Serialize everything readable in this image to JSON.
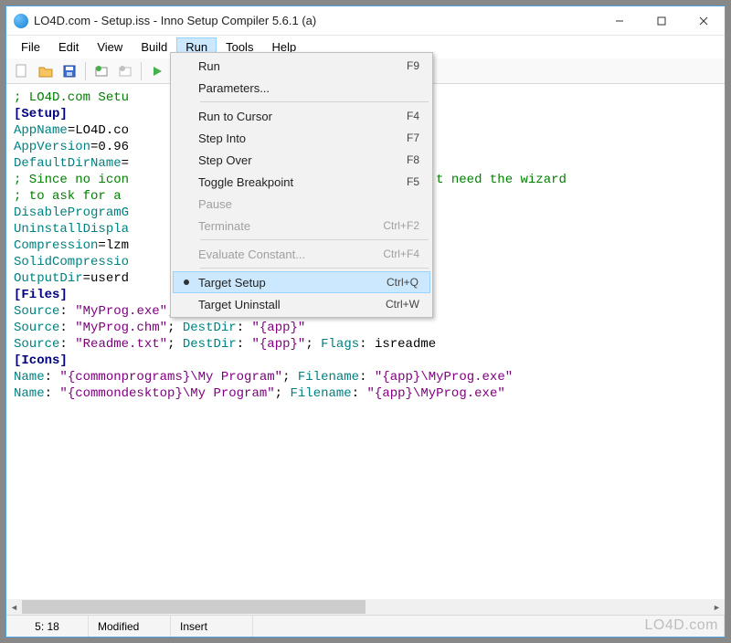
{
  "title": "LO4D.com - Setup.iss - Inno Setup Compiler 5.6.1 (a)",
  "menubar": [
    "File",
    "Edit",
    "View",
    "Build",
    "Run",
    "Tools",
    "Help"
  ],
  "active_menu_index": 4,
  "dropdown": {
    "items": [
      {
        "label": "Run",
        "accel": "F9",
        "type": "item"
      },
      {
        "label": "Parameters...",
        "accel": "",
        "type": "item"
      },
      {
        "type": "sep"
      },
      {
        "label": "Run to Cursor",
        "accel": "F4",
        "type": "item"
      },
      {
        "label": "Step Into",
        "accel": "F7",
        "type": "item"
      },
      {
        "label": "Step Over",
        "accel": "F8",
        "type": "item"
      },
      {
        "label": "Toggle Breakpoint",
        "accel": "F5",
        "type": "item"
      },
      {
        "label": "Pause",
        "accel": "",
        "type": "item",
        "disabled": true
      },
      {
        "label": "Terminate",
        "accel": "Ctrl+F2",
        "type": "item",
        "disabled": true
      },
      {
        "type": "sep"
      },
      {
        "label": "Evaluate Constant...",
        "accel": "Ctrl+F4",
        "type": "item",
        "disabled": true
      },
      {
        "type": "sep"
      },
      {
        "label": "Target Setup",
        "accel": "Ctrl+Q",
        "type": "item",
        "bullet": true,
        "hover": true
      },
      {
        "label": "Target Uninstall",
        "accel": "Ctrl+W",
        "type": "item"
      }
    ]
  },
  "editor": {
    "lines": [
      [
        {
          "c": "c-green",
          "t": "; LO4D.com Setu"
        }
      ],
      [
        {
          "t": ""
        }
      ],
      [
        {
          "c": "c-navy c-bold",
          "t": "[Setup]"
        }
      ],
      [
        {
          "c": "c-teal",
          "t": "AppName"
        },
        {
          "t": "=LO4D.co"
        }
      ],
      [
        {
          "c": "c-teal",
          "t": "AppVersion"
        },
        {
          "t": "=0.96"
        }
      ],
      [
        {
          "c": "c-teal",
          "t": "DefaultDirName"
        },
        {
          "t": "="
        }
      ],
      [
        {
          "c": "c-green",
          "t": "; Since no icon                              \", we don't need the wizard"
        }
      ],
      [
        {
          "c": "c-green",
          "t": "; to ask for a "
        }
      ],
      [
        {
          "c": "c-teal",
          "t": "DisableProgramG"
        }
      ],
      [
        {
          "c": "c-teal",
          "t": "UninstallDispla"
        }
      ],
      [
        {
          "c": "c-teal",
          "t": "Compression"
        },
        {
          "t": "=lzm"
        }
      ],
      [
        {
          "c": "c-teal",
          "t": "SolidCompressio"
        }
      ],
      [
        {
          "c": "c-teal",
          "t": "OutputDir"
        },
        {
          "t": "=userd                             t"
        }
      ],
      [
        {
          "t": ""
        }
      ],
      [
        {
          "c": "c-navy c-bold",
          "t": "[Files]"
        }
      ],
      [
        {
          "c": "c-teal",
          "t": "Source"
        },
        {
          "t": ": "
        },
        {
          "c": "c-purple",
          "t": "\"MyProg.exe\""
        },
        {
          "t": "; "
        },
        {
          "c": "c-teal",
          "t": "DestDir"
        },
        {
          "t": ": "
        },
        {
          "c": "c-purple",
          "t": "\"{app}\""
        }
      ],
      [
        {
          "c": "c-teal",
          "t": "Source"
        },
        {
          "t": ": "
        },
        {
          "c": "c-purple",
          "t": "\"MyProg.chm\""
        },
        {
          "t": "; "
        },
        {
          "c": "c-teal",
          "t": "DestDir"
        },
        {
          "t": ": "
        },
        {
          "c": "c-purple",
          "t": "\"{app}\""
        }
      ],
      [
        {
          "c": "c-teal",
          "t": "Source"
        },
        {
          "t": ": "
        },
        {
          "c": "c-purple",
          "t": "\"Readme.txt\""
        },
        {
          "t": "; "
        },
        {
          "c": "c-teal",
          "t": "DestDir"
        },
        {
          "t": ": "
        },
        {
          "c": "c-purple",
          "t": "\"{app}\""
        },
        {
          "t": "; "
        },
        {
          "c": "c-teal",
          "t": "Flags"
        },
        {
          "t": ": isreadme"
        }
      ],
      [
        {
          "t": ""
        }
      ],
      [
        {
          "c": "c-navy c-bold",
          "t": "[Icons]"
        }
      ],
      [
        {
          "c": "c-teal",
          "t": "Name"
        },
        {
          "t": ": "
        },
        {
          "c": "c-purple",
          "t": "\"{commonprograms}\\My Program\""
        },
        {
          "t": "; "
        },
        {
          "c": "c-teal",
          "t": "Filename"
        },
        {
          "t": ": "
        },
        {
          "c": "c-purple",
          "t": "\"{app}\\MyProg.exe\""
        }
      ],
      [
        {
          "c": "c-teal",
          "t": "Name"
        },
        {
          "t": ": "
        },
        {
          "c": "c-purple",
          "t": "\"{commondesktop}\\My Program\""
        },
        {
          "t": "; "
        },
        {
          "c": "c-teal",
          "t": "Filename"
        },
        {
          "t": ": "
        },
        {
          "c": "c-purple",
          "t": "\"{app}\\MyProg.exe\""
        }
      ]
    ]
  },
  "status": {
    "pos": "5:  18",
    "state": "Modified",
    "mode": "Insert"
  },
  "watermark": "LO4D.com"
}
